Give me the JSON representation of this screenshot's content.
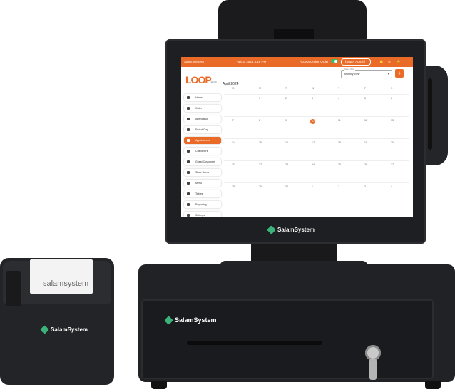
{
  "device": {
    "brand": "SalamSystem",
    "receipt_text": "salamsystem"
  },
  "app": {
    "logo": "LOOP",
    "logo_sub": "POS",
    "topbar": {
      "left": "SalamSystem",
      "datetime": "Apr 3, 2024 3:18 PM",
      "accept_online_order": "Accept Online Order",
      "status": "[Super Admin]"
    },
    "calendar": {
      "month": "April 2024",
      "view_label": "Select View",
      "view_value": "Monthly View",
      "weekdays": [
        "S",
        "M",
        "T",
        "W",
        "T",
        "F",
        "S"
      ],
      "weeks": [
        [
          "",
          "1",
          "2",
          "3",
          "4",
          "5",
          "6"
        ],
        [
          "7",
          "8",
          "9",
          "10",
          "11",
          "12",
          "13"
        ],
        [
          "14",
          "15",
          "16",
          "17",
          "18",
          "19",
          "20"
        ],
        [
          "21",
          "22",
          "23",
          "24",
          "25",
          "26",
          "27"
        ],
        [
          "28",
          "29",
          "30",
          "1",
          "2",
          "3",
          "4"
        ]
      ],
      "today": "10"
    },
    "sidebar": [
      {
        "label": "Home",
        "icon": "home-icon"
      },
      {
        "label": "Order",
        "icon": "cart-icon"
      },
      {
        "label": "Attendance",
        "icon": "calendar-check-icon"
      },
      {
        "label": "End of Day",
        "icon": "moon-icon"
      },
      {
        "label": "Appointment",
        "icon": "calendar-icon",
        "active": true
      },
      {
        "label": "Customers",
        "icon": "user-icon"
      },
      {
        "label": "Guest Customers",
        "icon": "guest-icon"
      },
      {
        "label": "Store Users",
        "icon": "users-icon"
      },
      {
        "label": "Menu",
        "icon": "menu-icon"
      },
      {
        "label": "Tables",
        "icon": "table-icon"
      },
      {
        "label": "Reporting",
        "icon": "chart-icon"
      },
      {
        "label": "Settings",
        "icon": "gear-icon"
      }
    ],
    "colors": {
      "accent": "#ea6b27",
      "toggle": "#2fbf6b"
    }
  }
}
